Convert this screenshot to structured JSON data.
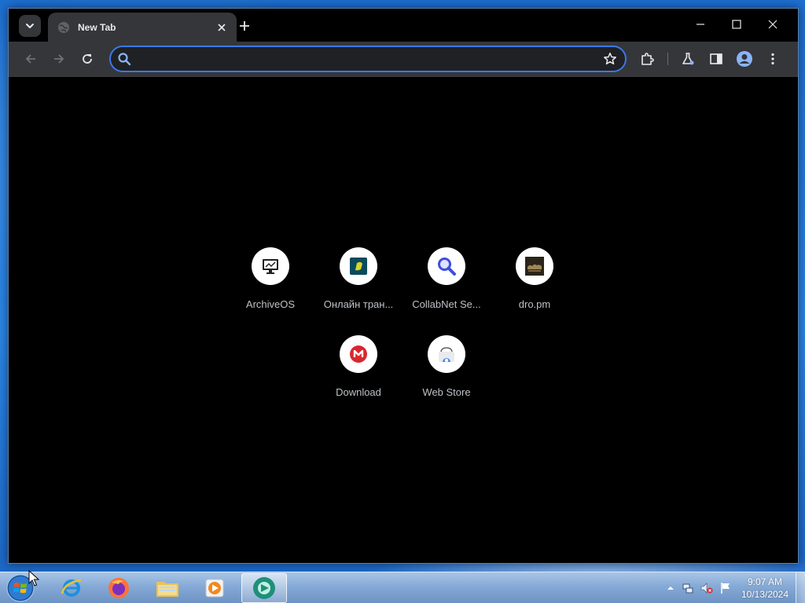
{
  "browser": {
    "tab": {
      "title": "New Tab"
    },
    "omnibox": {
      "value": "",
      "placeholder": ""
    },
    "accent_color": "#3b78e7"
  },
  "shortcuts": [
    {
      "label": "ArchiveOS",
      "icon": "monitor-icon"
    },
    {
      "label": "Онлайн тран...",
      "icon": "tv-logo-icon"
    },
    {
      "label": "CollabNet Se...",
      "icon": "magnifier-icon"
    },
    {
      "label": "dro.pm",
      "icon": "dro-thumbnail-icon"
    },
    {
      "label": "Download",
      "icon": "mega-icon"
    },
    {
      "label": "Web Store",
      "icon": "web-store-icon"
    }
  ],
  "taskbar": {
    "apps": [
      {
        "name": "internet-explorer",
        "icon": "ie-icon"
      },
      {
        "name": "firefox",
        "icon": "firefox-icon"
      },
      {
        "name": "file-explorer",
        "icon": "folder-icon"
      },
      {
        "name": "media-player",
        "icon": "media-player-icon"
      },
      {
        "name": "chrome-like-browser",
        "icon": "browser-icon",
        "active": true
      }
    ],
    "clock": {
      "time": "9:07 AM",
      "date": "10/13/2024"
    }
  }
}
